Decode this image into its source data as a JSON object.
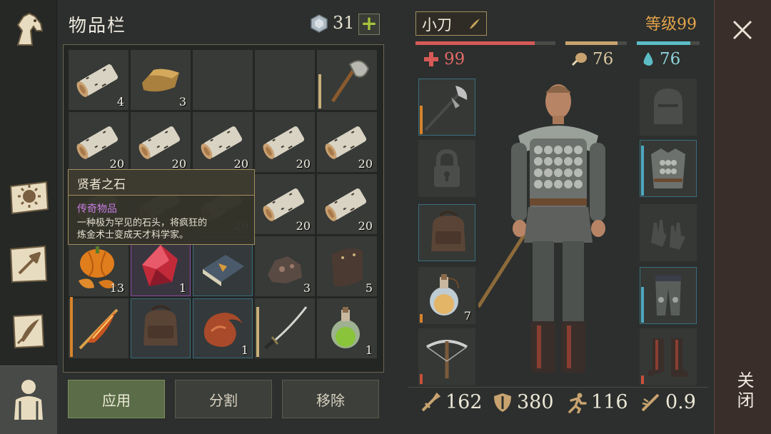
{
  "nav": {
    "items": [
      {
        "name": "horse-icon"
      },
      {
        "name": "sun-book-icon"
      },
      {
        "name": "crafting-arrow-icon"
      },
      {
        "name": "scroll-quill-icon"
      },
      {
        "name": "character-icon",
        "active": true
      }
    ]
  },
  "inventory": {
    "title": "物品栏",
    "gems": "31",
    "gem_plus": "+",
    "slots": [
      {
        "icon": "birch-log-icon",
        "qty": "4"
      },
      {
        "icon": "bread-loaf-icon",
        "qty": "3"
      },
      {
        "icon": "",
        "qty": ""
      },
      {
        "icon": "",
        "qty": ""
      },
      {
        "icon": "axe-icon",
        "qty": ""
      },
      {
        "icon": "birch-log-icon",
        "qty": "20"
      },
      {
        "icon": "birch-log-icon",
        "qty": "20"
      },
      {
        "icon": "birch-log-icon",
        "qty": "20"
      },
      {
        "icon": "birch-log-icon",
        "qty": "20"
      },
      {
        "icon": "birch-log-icon",
        "qty": "20"
      },
      {
        "icon": "birch-log-icon",
        "qty": ""
      },
      {
        "icon": "birch-log-icon",
        "qty": ""
      },
      {
        "icon": "birch-log-icon",
        "qty": "20"
      },
      {
        "icon": "birch-log-icon",
        "qty": "20"
      },
      {
        "icon": "birch-log-icon",
        "qty": "20"
      },
      {
        "icon": "pumpkin-icon",
        "qty": "13"
      },
      {
        "icon": "red-crystal-icon",
        "qty": "1"
      },
      {
        "icon": "tome-icon",
        "qty": ""
      },
      {
        "icon": "ore-icon",
        "qty": "3"
      },
      {
        "icon": "leather-plate-icon",
        "qty": "5"
      },
      {
        "icon": "flame-sword-icon",
        "qty": ""
      },
      {
        "icon": "backpack-icon",
        "qty": ""
      },
      {
        "icon": "seed-icon",
        "qty": "1"
      },
      {
        "icon": "katana-icon",
        "qty": ""
      },
      {
        "icon": "potion-icon",
        "qty": "1"
      }
    ],
    "tooltip": {
      "name": "贤者之石",
      "rarity": "传奇物品",
      "desc_line1": "一种极为罕见的石头，将疯狂的",
      "desc_line2": "炼金术士变成天才科学家。"
    },
    "buttons": {
      "apply": "应用",
      "split": "分割",
      "remove": "移除"
    }
  },
  "character": {
    "name": "小刀",
    "level": "等级99",
    "health": "99",
    "food": "76",
    "water": "76",
    "bars": {
      "health": 0.85,
      "food": 0.85,
      "water": 0.85
    },
    "equipment_left": [
      {
        "icon": "halberd-icon",
        "qty": ""
      },
      {
        "icon": "lock-icon",
        "qty": ""
      },
      {
        "icon": "backpack-icon",
        "qty": ""
      },
      {
        "icon": "potion-flask-icon",
        "qty": "7"
      },
      {
        "icon": "crossbow-icon",
        "qty": ""
      }
    ],
    "equipment_right": [
      {
        "icon": "helmet-placeholder-icon",
        "qty": ""
      },
      {
        "icon": "chest-armor-icon",
        "qty": ""
      },
      {
        "icon": "gloves-placeholder-icon",
        "qty": ""
      },
      {
        "icon": "leg-armor-icon",
        "qty": ""
      },
      {
        "icon": "boots-icon",
        "qty": ""
      }
    ],
    "stats": {
      "attack": "162",
      "armor": "380",
      "speed": "116",
      "crit": "0.9"
    }
  },
  "close": {
    "label": "关闭"
  },
  "colors": {
    "health": "#d65a57",
    "food": "#c8a370",
    "water": "#5bbcc6",
    "accent": "#a38e5e",
    "level": "#e3a34c"
  }
}
